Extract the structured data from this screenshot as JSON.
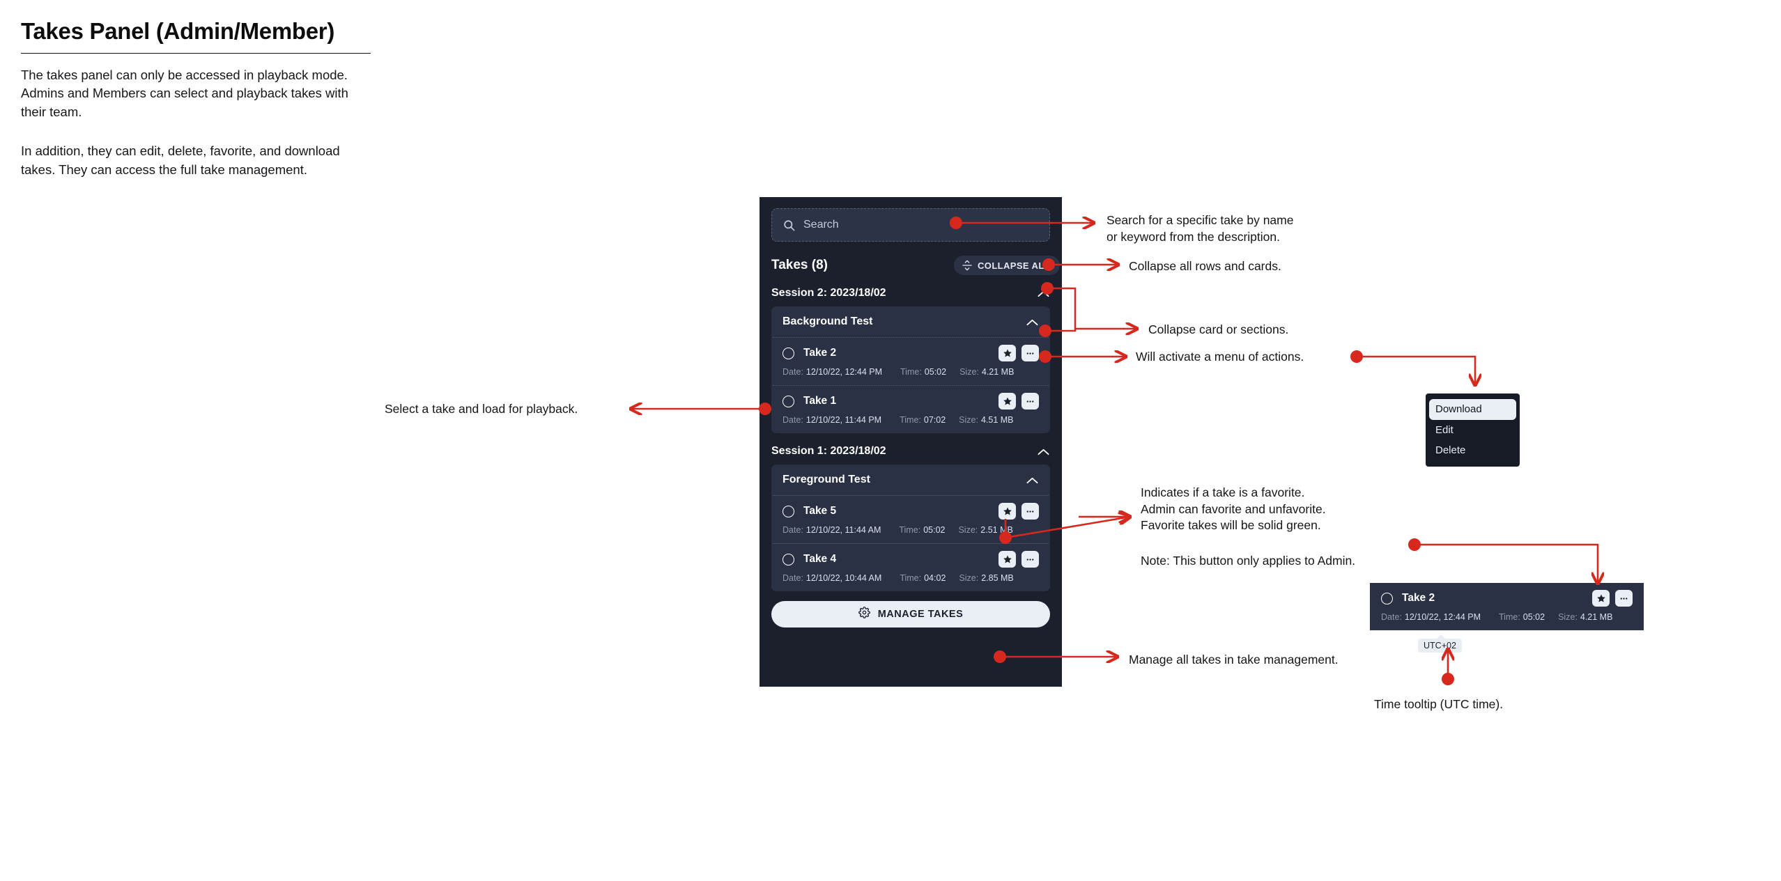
{
  "doc": {
    "title": "Takes Panel (Admin/Member)",
    "paragraph1": "The takes panel can only be accessed in playback mode. Admins and Members can select and playback takes with their team.",
    "paragraph2": "In addition, they can edit, delete, favorite, and download takes. They can access the full take management."
  },
  "panel": {
    "search": {
      "placeholder": "Search",
      "icon": "search-icon"
    },
    "takes_title": "Takes (8)",
    "collapse_all_label": "COLLAPSE ALL",
    "collapse_all_icon": "collapse-all-icon",
    "sessions": [
      {
        "label": "Session 2: 2023/18/02",
        "expanded": true,
        "cards": [
          {
            "title": "Background Test",
            "expanded": true,
            "takes": [
              {
                "name": "Take 2",
                "selected": false,
                "favorite": false,
                "date_label": "Date:",
                "date_value": "12/10/22, 12:44  PM",
                "time_label": "Time:",
                "time_value": "05:02",
                "size_label": "Size:",
                "size_value": "4.21 MB"
              },
              {
                "name": "Take 1",
                "selected": false,
                "favorite": false,
                "date_label": "Date:",
                "date_value": "12/10/22, 11:44  PM",
                "time_label": "Time:",
                "time_value": "07:02",
                "size_label": "Size:",
                "size_value": "4.51 MB"
              }
            ]
          }
        ]
      },
      {
        "label": "Session 1: 2023/18/02",
        "expanded": true,
        "cards": [
          {
            "title": "Foreground Test",
            "expanded": true,
            "takes": [
              {
                "name": "Take 5",
                "selected": false,
                "favorite": false,
                "date_label": "Date:",
                "date_value": "12/10/22, 11:44  AM",
                "time_label": "Time:",
                "time_value": "05:02",
                "size_label": "Size:",
                "size_value": "2.51 MB"
              },
              {
                "name": "Take 4",
                "selected": false,
                "favorite": false,
                "date_label": "Date:",
                "date_value": "12/10/22, 10:44  AM",
                "time_label": "Time:",
                "time_value": "04:02",
                "size_label": "Size:",
                "size_value": "2.85 MB"
              }
            ]
          }
        ]
      }
    ],
    "manage_button_label": "MANAGE TAKES",
    "manage_button_icon": "gear-icon"
  },
  "context_menu": {
    "items": [
      {
        "label": "Download",
        "highlighted": true
      },
      {
        "label": "Edit",
        "highlighted": false
      },
      {
        "label": "Delete",
        "highlighted": false
      }
    ]
  },
  "float_take": {
    "name": "Take 2",
    "date_label": "Date:",
    "date_value": "12/10/22, 12:44  PM",
    "time_label": "Time:",
    "time_value": "05:02",
    "size_label": "Size:",
    "size_value": "4.21 MB",
    "tooltip": "UTC+02"
  },
  "annotations": {
    "search": "Search for a specific take by name\nor keyword from the description.",
    "collapse_all": "Collapse all rows and cards.",
    "collapse_card": "Collapse card or sections.",
    "menu_actions": "Will activate a menu of actions.",
    "select_take": "Select a take and load for playback.",
    "favorite": "Indicates if a take is a favorite.\nAdmin can favorite and unfavorite.\nFavorite takes will be solid green.",
    "favorite_note": "Note: This button only applies to Admin.",
    "manage_takes": "Manage all takes in take management.",
    "tooltip_note": "Time tooltip (UTC time)."
  },
  "colors": {
    "annotation_red": "#d7281e",
    "panel_bg": "#1b202c",
    "card_bg": "#2a3145",
    "accent_light": "#eaeff5"
  }
}
